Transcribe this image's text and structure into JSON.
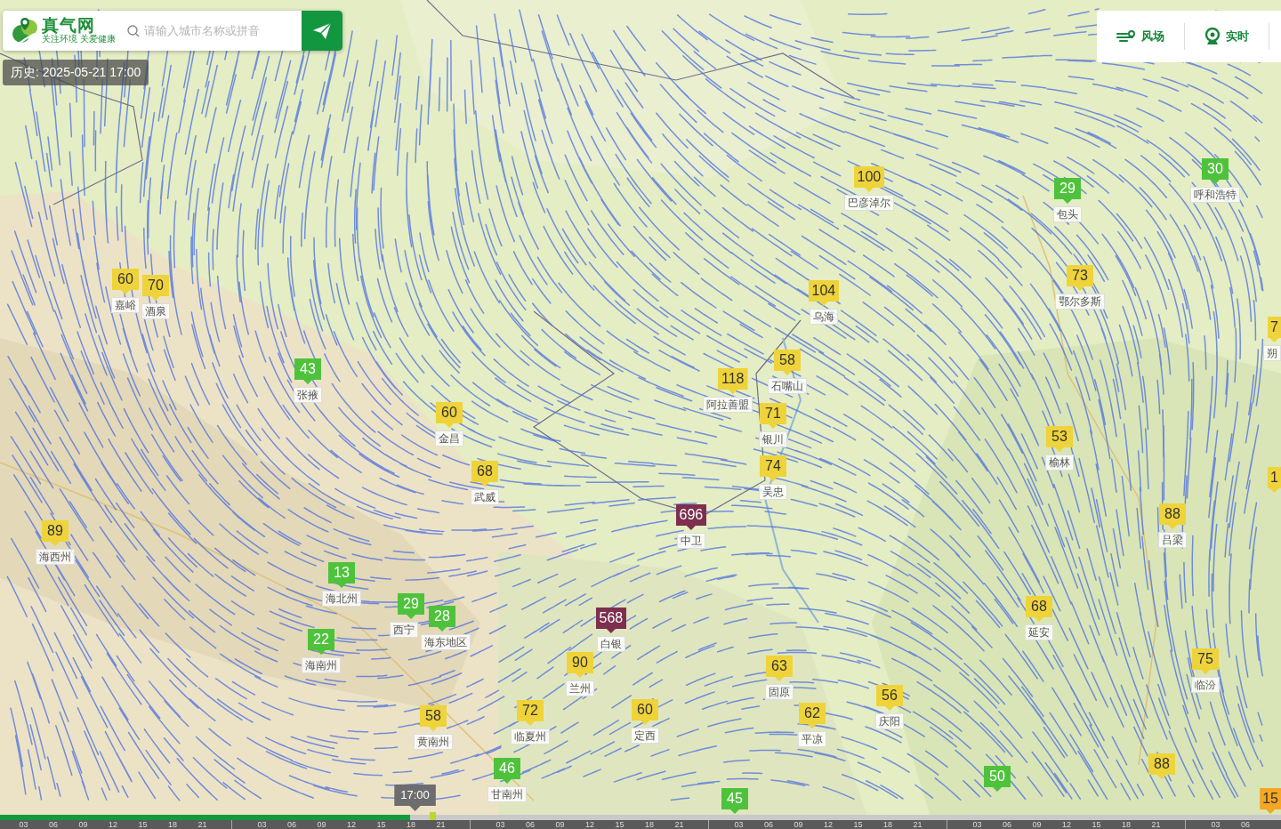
{
  "logo": {
    "title": "真气网",
    "tagline": "关注环境 关爱健康"
  },
  "search": {
    "placeholder": "请输入城市名称或拼音"
  },
  "history": "历史: 2025-05-21 17:00",
  "toolbar": [
    {
      "label": "风场",
      "kind": "wind"
    },
    {
      "label": "实时",
      "kind": "realtime"
    }
  ],
  "markers": [
    {
      "value": "60",
      "label": "嘉峪",
      "color": "#efd33b"
    },
    {
      "value": "70",
      "label": "酒泉",
      "color": "#efd33b"
    },
    {
      "value": "43",
      "label": "张掖",
      "color": "#4fc23c"
    },
    {
      "value": "60",
      "label": "金昌",
      "color": "#efd33b"
    },
    {
      "value": "68",
      "label": "武威",
      "color": "#efd33b"
    },
    {
      "value": "89",
      "label": "海西州",
      "color": "#efd33b"
    },
    {
      "value": "13",
      "label": "海北州",
      "color": "#4fc23c"
    },
    {
      "value": "29",
      "label": "西宁",
      "color": "#4fc23c"
    },
    {
      "value": "28",
      "label": "海东地区",
      "color": "#4fc23c"
    },
    {
      "value": "22",
      "label": "海南州",
      "color": "#4fc23c"
    },
    {
      "value": "568",
      "label": "白银",
      "color": "#7d2f4e"
    },
    {
      "value": "90",
      "label": "兰州",
      "color": "#efd33b"
    },
    {
      "value": "58",
      "label": "黄南州",
      "color": "#efd33b"
    },
    {
      "value": "72",
      "label": "临夏州",
      "color": "#efd33b"
    },
    {
      "value": "60",
      "label": "定西",
      "color": "#efd33b"
    },
    {
      "value": "46",
      "label": "甘南州",
      "color": "#4fc23c"
    },
    {
      "value": "45",
      "color": "#4fc23c"
    },
    {
      "value": "696",
      "label": "中卫",
      "color": "#7d2f4e"
    },
    {
      "value": "100",
      "label": "巴彦淖尔",
      "color": "#efd33b"
    },
    {
      "value": "29",
      "label": "包头",
      "color": "#4fc23c"
    },
    {
      "value": "30",
      "label": "呼和浩特",
      "color": "#4fc23c"
    },
    {
      "value": "104",
      "label": "乌海",
      "color": "#efd33b"
    },
    {
      "value": "73",
      "label": "鄂尔多斯",
      "color": "#efd33b"
    },
    {
      "value": "58",
      "label": "石嘴山",
      "color": "#efd33b"
    },
    {
      "value": "118",
      "label": "阿拉善盟",
      "color": "#efd33b"
    },
    {
      "value": "71",
      "label": "银川",
      "color": "#efd33b"
    },
    {
      "value": "74",
      "label": "吴忠",
      "color": "#efd33b"
    },
    {
      "value": "53",
      "label": "榆林",
      "color": "#efd33b"
    },
    {
      "value": "88",
      "label": "吕梁",
      "color": "#efd33b"
    },
    {
      "value": "68",
      "label": "延安",
      "color": "#efd33b"
    },
    {
      "value": "75",
      "label": "临汾",
      "color": "#efd33b"
    },
    {
      "value": "63",
      "label": "固原",
      "color": "#efd33b"
    },
    {
      "value": "56",
      "label": "庆阳",
      "color": "#efd33b"
    },
    {
      "value": "62",
      "label": "平凉",
      "color": "#efd33b"
    },
    {
      "value": "88",
      "color": "#efd33b"
    },
    {
      "value": "50",
      "color": "#4fc23c"
    },
    {
      "value": "7",
      "label": "朔",
      "color": "#efd33b"
    },
    {
      "value": "1",
      "color": "#efd33b"
    },
    {
      "value": "15",
      "color": "#f5a623"
    }
  ],
  "timeline": {
    "level": 0.32,
    "current": "17:00",
    "days": [
      [
        "03",
        "06",
        "09",
        "12",
        "15",
        "18",
        "21"
      ],
      [
        "03",
        "06",
        "09",
        "12",
        "15",
        "18",
        "21"
      ],
      [
        "03",
        "06",
        "09",
        "12",
        "15",
        "18",
        "21"
      ],
      [
        "03",
        "06",
        "09",
        "12",
        "15",
        "18",
        "21"
      ],
      [
        "03",
        "06",
        "09",
        "12",
        "15",
        "18",
        "21"
      ],
      [
        "03",
        "06"
      ]
    ]
  }
}
